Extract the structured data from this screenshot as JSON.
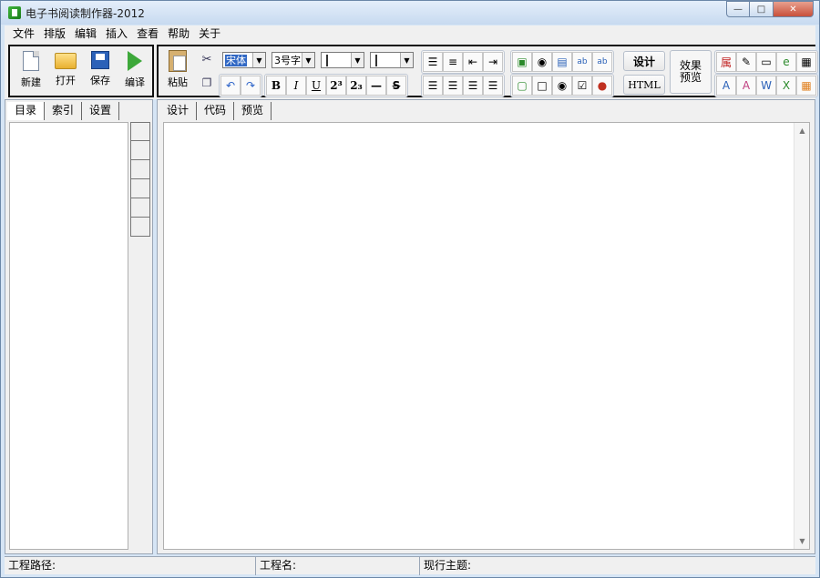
{
  "window": {
    "title": "电子书阅读制作器-2012"
  },
  "window_controls": {
    "minimize": "—",
    "maximize": "□",
    "close": "✕"
  },
  "menu": [
    "文件",
    "排版",
    "编辑",
    "插入",
    "查看",
    "帮助",
    "关于"
  ],
  "file_group": {
    "new": "新建",
    "open": "打开",
    "save": "保存",
    "compile": "编译"
  },
  "edit_group": {
    "paste": "粘贴"
  },
  "format": {
    "font": "宋体",
    "size": "3号字",
    "fore_color": "#000000",
    "back_color": "#ffffff",
    "bold": "B",
    "italic": "I",
    "underline": "U",
    "superscript": "2³",
    "subscript": "2₃",
    "hr": "—",
    "strike": "S"
  },
  "mode_buttons": {
    "design": "设计",
    "html": "HTML"
  },
  "preview": {
    "line1": "效果",
    "line2": "预览"
  },
  "left_tabs": [
    "目录",
    "索引",
    "设置"
  ],
  "editor_tabs": [
    "设计",
    "代码",
    "预览"
  ],
  "status": {
    "path_label": "工程路径:",
    "name_label": "工程名:",
    "theme_label": "现行主题:"
  },
  "colors": {
    "frame": "#d6e5f5",
    "panel": "#f0f0f0",
    "accent": "#3168c4"
  }
}
